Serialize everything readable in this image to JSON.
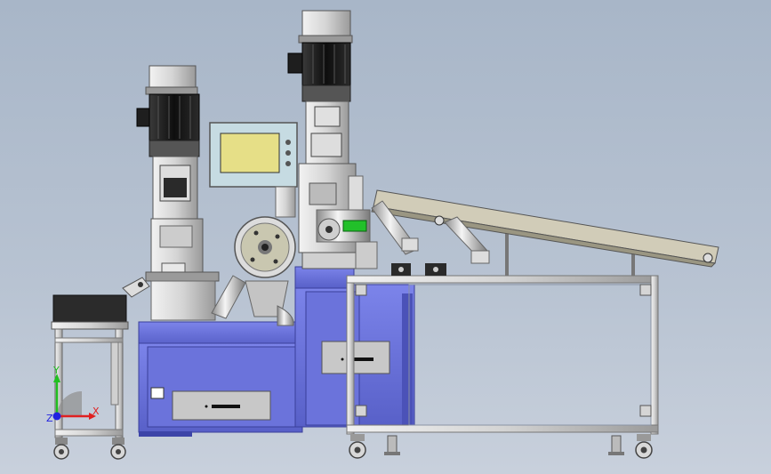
{
  "viewport": {
    "background_top": "#a8b6c8",
    "background_bottom": "#c8d0dc"
  },
  "colors": {
    "frame_blue": "#6a72d8",
    "frame_blue_dark": "#3c44a8",
    "motor_black": "#1b1b1b",
    "steel_light": "#e4e4e4",
    "steel_mid": "#b8b8b8",
    "steel_dark": "#6c6c6c",
    "screen_yellow": "#e8e08a",
    "screen_frame": "#b8d0d8",
    "accent_green": "#22c02a",
    "conveyor_tan": "#cfcab6"
  },
  "triad": {
    "x_label": "X",
    "y_label": "Y",
    "z_label": "Z",
    "x_color": "#e02020",
    "y_color": "#20c020",
    "z_color": "#2020e0"
  }
}
